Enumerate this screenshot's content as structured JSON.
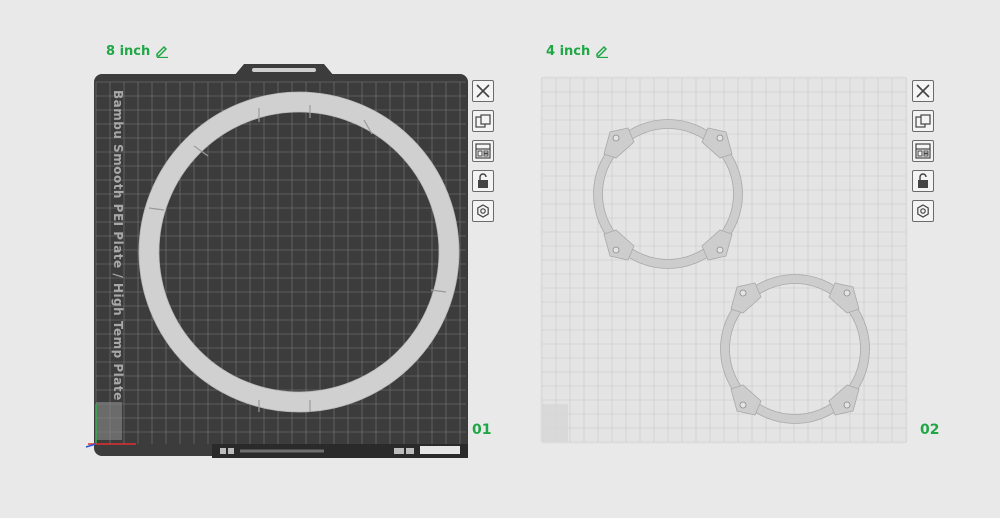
{
  "plates": [
    {
      "title": "8 inch",
      "number": "01",
      "bed_label": "Bambu Smooth PEI Plate / High Temp Plate",
      "bed_color": "#3c3c3c",
      "grid_color": "#7a7a7a",
      "part_color": "#d0d0d0"
    },
    {
      "title": "4 inch",
      "number": "02",
      "bed_color": "#e4e4e4",
      "grid_color": "#c8c8c8",
      "part_color": "#cdcdcd"
    }
  ],
  "toolbar_tools": [
    "close-icon",
    "arrange-icon",
    "layout-icon",
    "lock-icon",
    "settings-icon"
  ],
  "accent_color": "#1fa745"
}
